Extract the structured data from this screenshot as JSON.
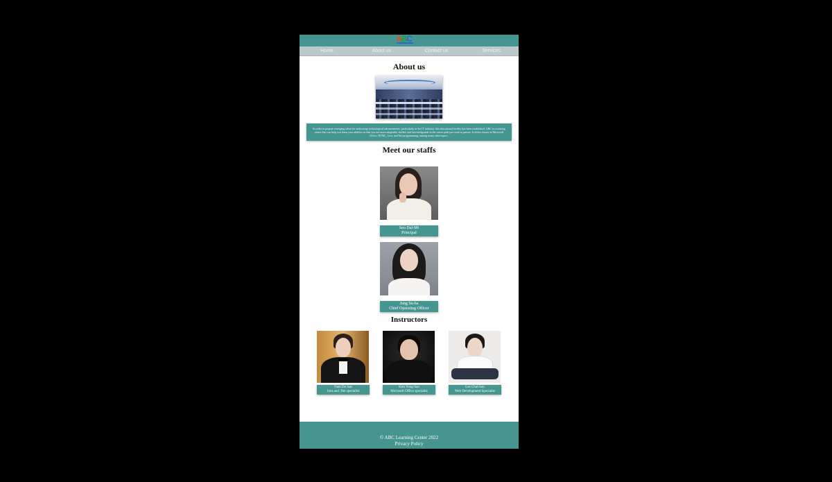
{
  "brand": {
    "logo_text": "ABC"
  },
  "nav": {
    "items": [
      "Home",
      "About us",
      "Contact us",
      "Services"
    ]
  },
  "about": {
    "heading": "About us",
    "text": "In order to prepare emerging talent for embracing technological advancements, particularly in the IT industry, this educational facility has been established. ABC is a training center that can help you learn your abilities so that you are more adaptable, skilled, and knowledgeable in the career path you want to pursue. It offers classes in Microsoft Office, HTML, Java, and Net programming, among many other topics."
  },
  "staff": {
    "heading": "Meet our staffs",
    "members": [
      {
        "name": "Seo Dal-Mi",
        "role": "Principal"
      },
      {
        "name": "Jung Su-ha",
        "role": "Chief Operating Officer"
      }
    ]
  },
  "instructors": {
    "heading": "Instructors",
    "members": [
      {
        "name": "Nam Do San",
        "role": "Java and .Net specialist"
      },
      {
        "name": "Kim Yong-San",
        "role": "Microsoft Office specialist"
      },
      {
        "name": "Lee Chul-San",
        "role": "Web Development Specialist"
      }
    ]
  },
  "footer": {
    "copyright": "© ABC Learning Center 2022",
    "privacy": "Privacy Policy"
  },
  "colors": {
    "accent": "#459591",
    "nav_bg": "#bcc9cc",
    "page_bg": "#000000"
  }
}
